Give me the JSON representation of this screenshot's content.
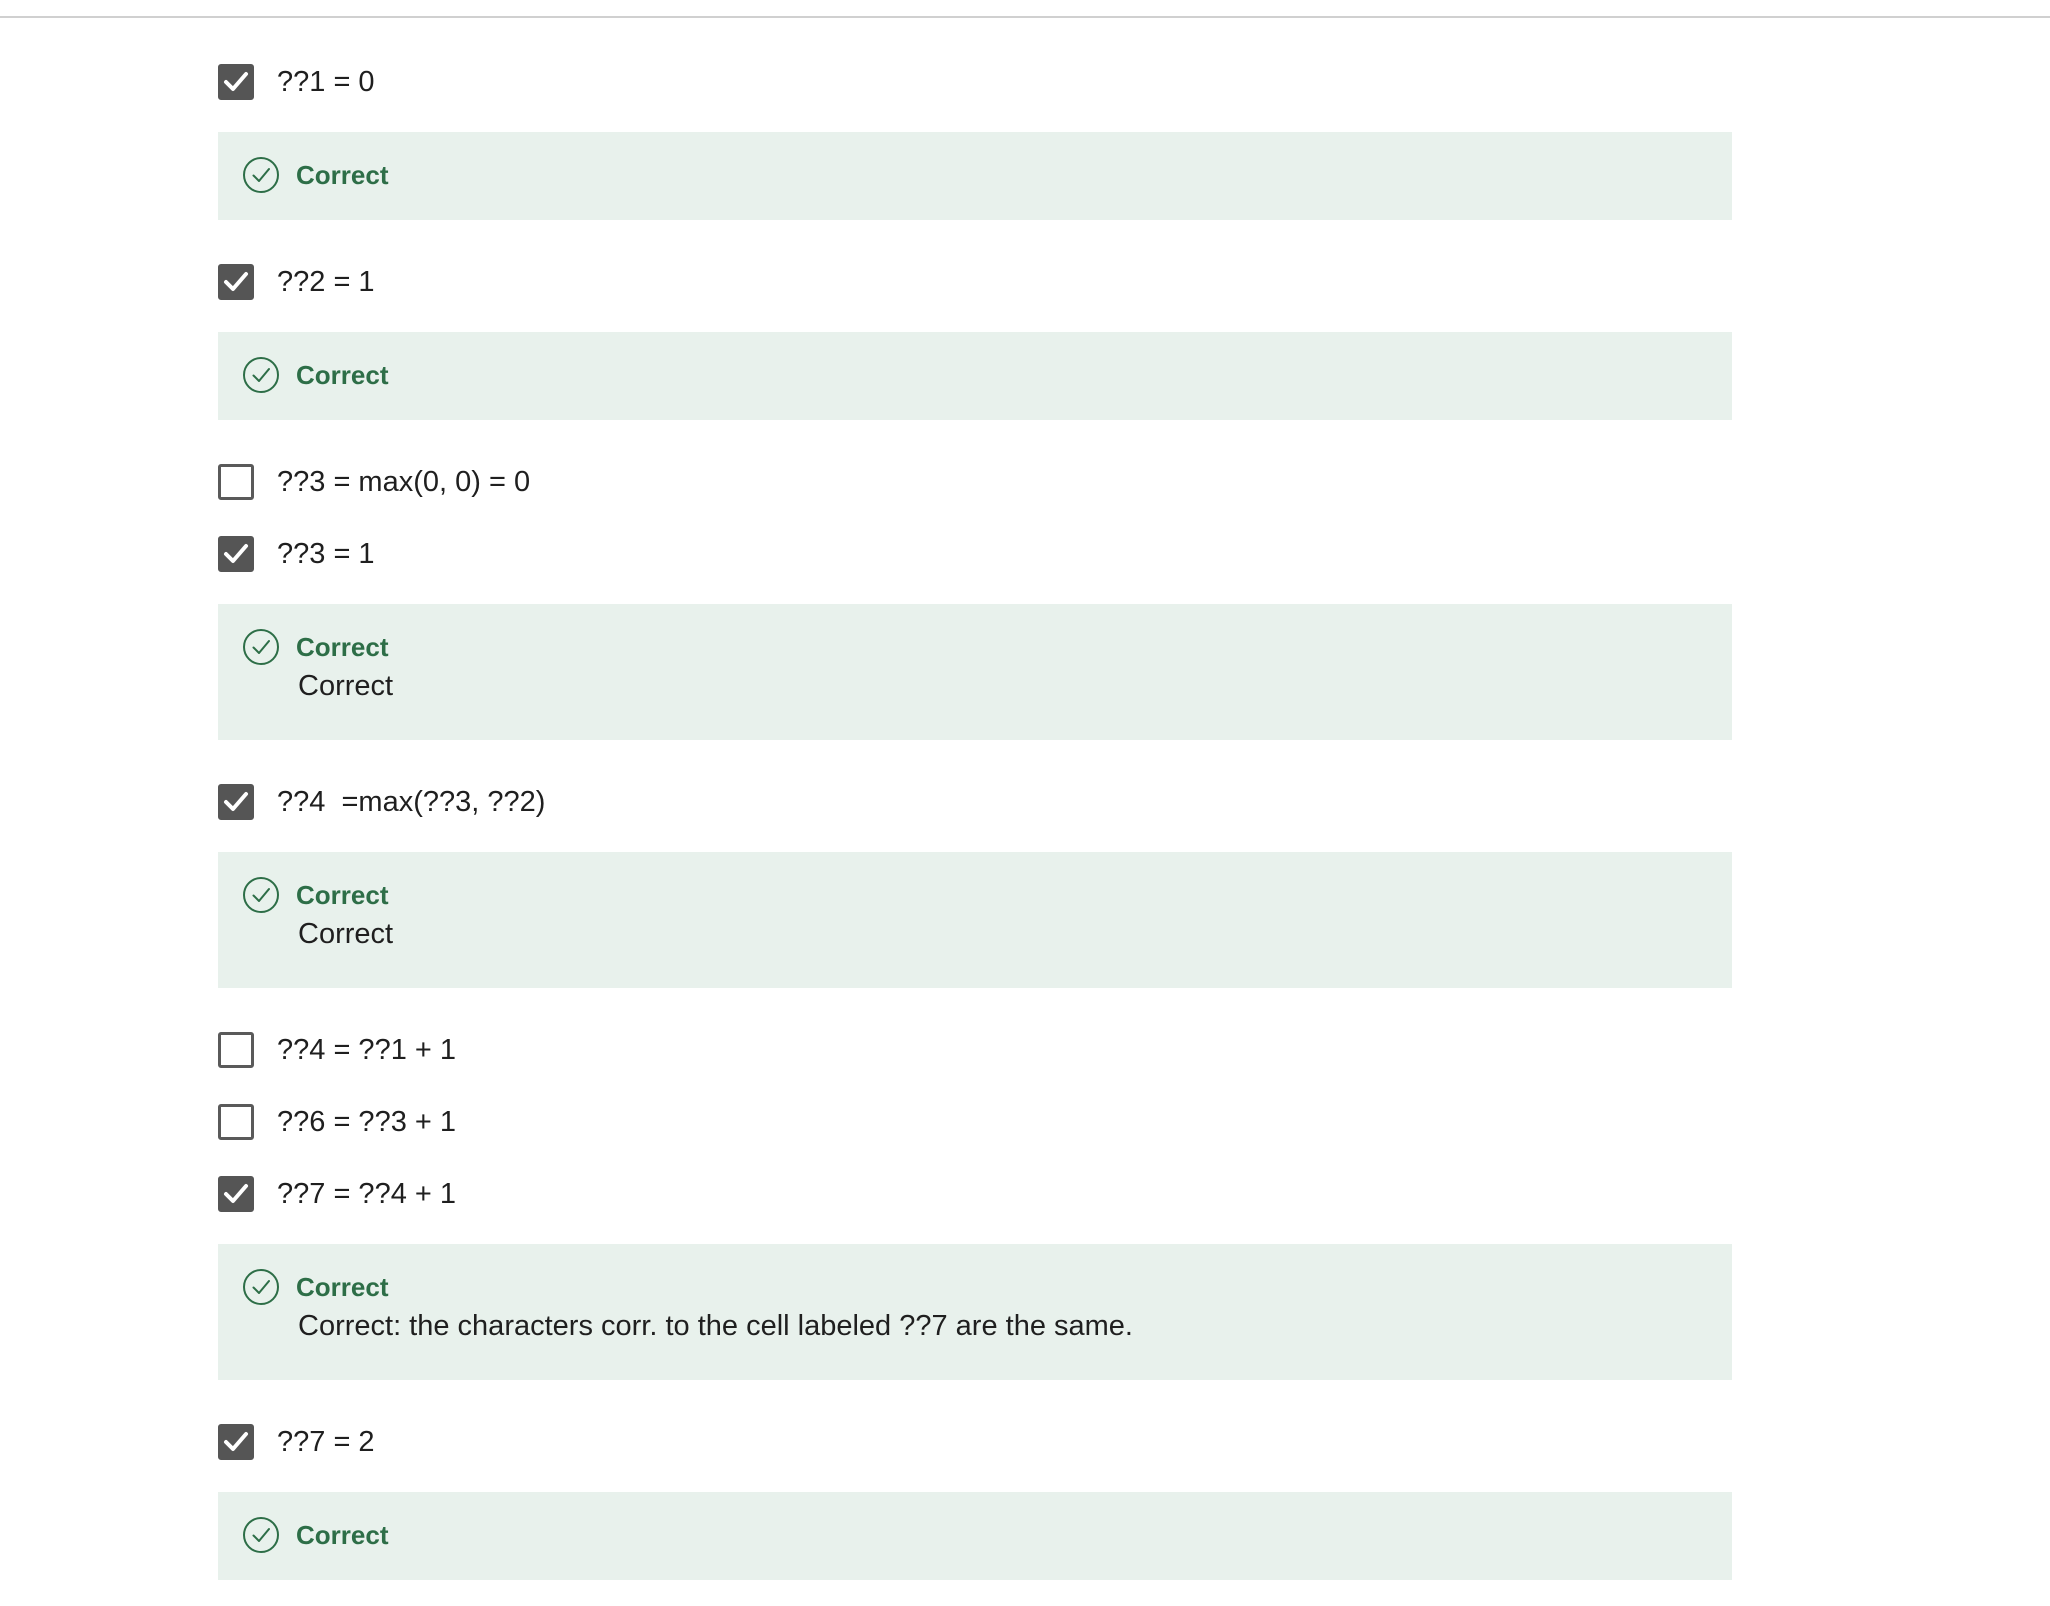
{
  "colors": {
    "feedback_background": "#e8f1ec",
    "correct_green": "#2d6e47",
    "checkbox_checked": "#555555"
  },
  "icons": {
    "checkbox_check": "check-mark-icon",
    "feedback_status": "check-circle-icon"
  },
  "items": [
    {
      "label": "??1 = 0",
      "checked": true,
      "feedback": {
        "title": "Correct",
        "text": ""
      }
    },
    {
      "label": "??2 = 1",
      "checked": true,
      "feedback": {
        "title": "Correct",
        "text": ""
      }
    },
    {
      "label": "??3 = max(0, 0) = 0",
      "checked": false
    },
    {
      "label": "??3 = 1",
      "checked": true,
      "feedback": {
        "title": "Correct",
        "text": "Correct"
      }
    },
    {
      "label": "??4  =max(??3, ??2)",
      "checked": true,
      "feedback": {
        "title": "Correct",
        "text": "Correct"
      }
    },
    {
      "label": "??4 = ??1 + 1",
      "checked": false
    },
    {
      "label": "??6 = ??3 + 1",
      "checked": false
    },
    {
      "label": "??7 = ??4 + 1",
      "checked": true,
      "feedback": {
        "title": "Correct",
        "text": "Correct: the characters corr. to the cell labeled ??7 are the same."
      }
    },
    {
      "label": "??7 = 2",
      "checked": true,
      "feedback": {
        "title": "Correct",
        "text": ""
      }
    }
  ]
}
